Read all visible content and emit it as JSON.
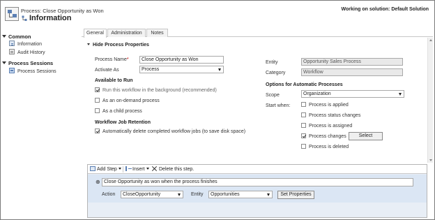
{
  "header": {
    "subtitle": "Process: Close Opportunity as Won",
    "title": "Information",
    "solution": "Working on solution: Default Solution"
  },
  "nav": {
    "sections": [
      {
        "label": "Common",
        "items": [
          {
            "label": "Information",
            "icon": "info-icon"
          },
          {
            "label": "Audit History",
            "icon": "audit-history-icon"
          }
        ]
      },
      {
        "label": "Process Sessions",
        "items": [
          {
            "label": "Process Sessions",
            "icon": "process-sessions-icon"
          }
        ]
      }
    ]
  },
  "tabs": [
    {
      "label": "General",
      "active": true
    },
    {
      "label": "Administration",
      "active": false
    },
    {
      "label": "Notes",
      "active": false
    }
  ],
  "form": {
    "section_title": "Hide Process Properties",
    "process_name": {
      "label": "Process Name",
      "required_mark": "*",
      "value": "Close Opportunity as Won"
    },
    "activate_as": {
      "label": "Activate As",
      "value": "Process"
    },
    "available_to_run": {
      "heading": "Available to Run",
      "options": [
        {
          "label": "Run this workflow in the background (recommended)",
          "checked": true,
          "disabled": true
        },
        {
          "label": "As an on-demand process",
          "checked": false,
          "disabled": false
        },
        {
          "label": "As a child process",
          "checked": false,
          "disabled": false
        }
      ]
    },
    "retention": {
      "heading": "Workflow Job Retention",
      "option": {
        "label": "Automatically delete completed workflow jobs (to save disk space)",
        "checked": true
      }
    },
    "entity": {
      "label": "Entity",
      "value": "Opportunity Sales Process"
    },
    "category": {
      "label": "Category",
      "value": "Workflow"
    },
    "automatic": {
      "heading": "Options for Automatic Processes",
      "scope": {
        "label": "Scope",
        "value": "Organization"
      },
      "start_when_label": "Start when:",
      "triggers": [
        {
          "label": "Process is applied",
          "checked": false
        },
        {
          "label": "Process status changes",
          "checked": false
        },
        {
          "label": "Process is assigned",
          "checked": false
        },
        {
          "label": "Process changes",
          "checked": true
        },
        {
          "label": "Process is deleted",
          "checked": false
        }
      ],
      "select_button": "Select"
    }
  },
  "steps": {
    "toolbar": {
      "add_step": "Add Step",
      "insert": "Insert",
      "delete": "Delete this step."
    },
    "step": {
      "bullet": "⊕",
      "description": "Close Opportunity as won when the process finishes",
      "action_label": "Action",
      "action_value": "CloseOpportunity",
      "entity_label": "Entity",
      "entity_value": "Opportunities",
      "set_properties": "Set Properties"
    }
  }
}
